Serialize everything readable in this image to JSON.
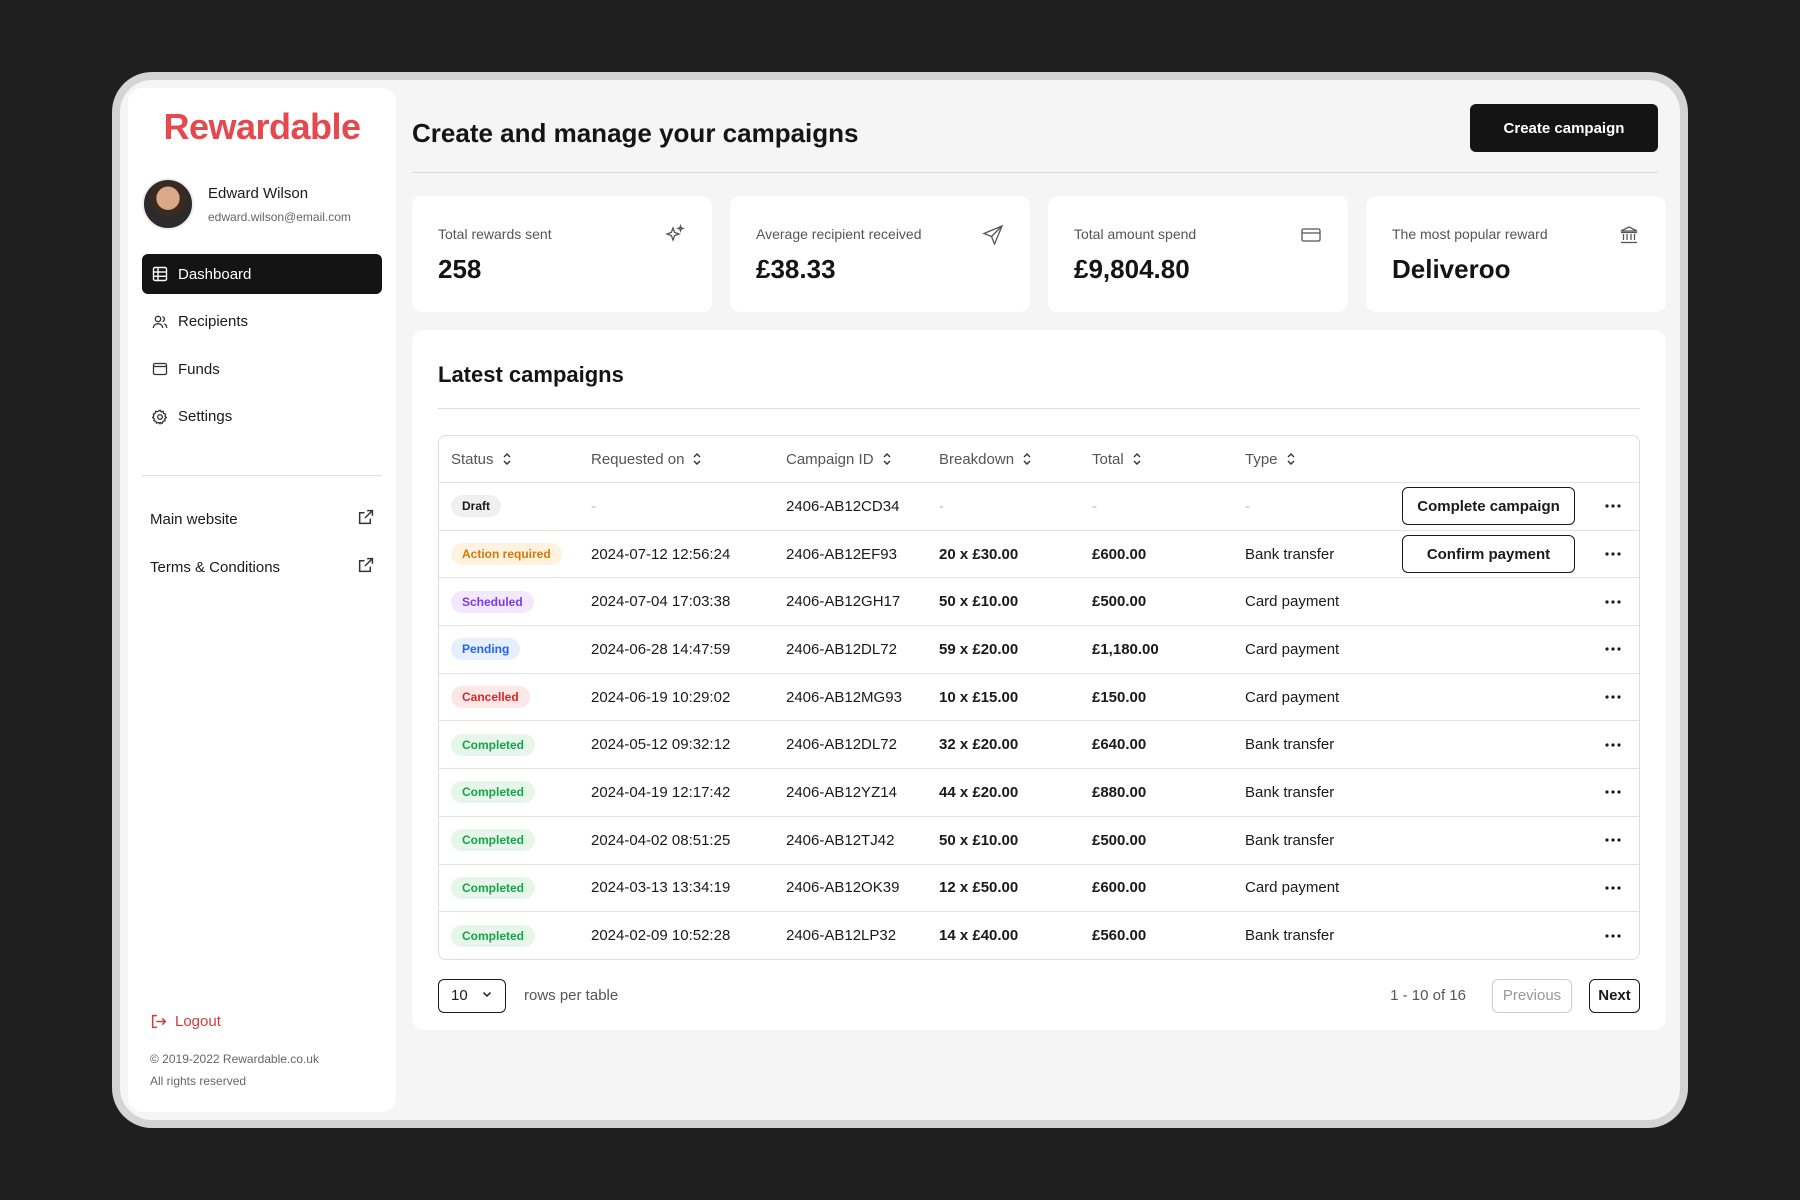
{
  "brand": {
    "name": "Rewardable",
    "color": "#e5484d"
  },
  "user": {
    "name": "Edward Wilson",
    "email": "edward.wilson@email.com"
  },
  "nav": [
    {
      "label": "Dashboard",
      "icon": "table-icon",
      "active": true
    },
    {
      "label": "Recipients",
      "icon": "users-icon",
      "active": false
    },
    {
      "label": "Funds",
      "icon": "wallet-icon",
      "active": false
    },
    {
      "label": "Settings",
      "icon": "gear-icon",
      "active": false
    }
  ],
  "links": [
    {
      "label": "Main website",
      "icon": "external-link-icon"
    },
    {
      "label": "Terms & Conditions",
      "icon": "external-link-icon"
    }
  ],
  "logout_label": "Logout",
  "footer": {
    "copyright": "© 2019-2022 Rewardable.co.uk",
    "rights": "All rights reserved"
  },
  "header": {
    "title": "Create and manage your campaigns",
    "create_label": "Create campaign"
  },
  "stats": [
    {
      "label": "Total rewards sent",
      "value": "258",
      "icon": "sparkle-icon"
    },
    {
      "label": "Average recipient received",
      "value": "£38.33",
      "icon": "send-icon"
    },
    {
      "label": "Total amount spend",
      "value": "£9,804.80",
      "icon": "card-icon"
    },
    {
      "label": "The most popular reward",
      "value": "Deliveroo",
      "icon": "bank-icon"
    }
  ],
  "campaigns": {
    "title": "Latest campaigns",
    "columns": [
      "Status",
      "Requested on",
      "Campaign ID",
      "Breakdown",
      "Total",
      "Type"
    ],
    "rows": [
      {
        "status": "Draft",
        "requested": "-",
        "id": "2406-AB12CD34",
        "breakdown": "-",
        "total": "-",
        "type": "-",
        "action": "Complete campaign"
      },
      {
        "status": "Action required",
        "requested": "2024-07-12 12:56:24",
        "id": "2406-AB12EF93",
        "breakdown": "20 x £30.00",
        "total": "£600.00",
        "type": "Bank transfer",
        "action": "Confirm payment"
      },
      {
        "status": "Scheduled",
        "requested": "2024-07-04 17:03:38",
        "id": "2406-AB12GH17",
        "breakdown": "50 x £10.00",
        "total": "£500.00",
        "type": "Card payment"
      },
      {
        "status": "Pending",
        "requested": "2024-06-28 14:47:59",
        "id": "2406-AB12DL72",
        "breakdown": "59 x £20.00",
        "total": "£1,180.00",
        "type": "Card payment"
      },
      {
        "status": "Cancelled",
        "requested": "2024-06-19 10:29:02",
        "id": "2406-AB12MG93",
        "breakdown": "10 x £15.00",
        "total": "£150.00",
        "type": "Card payment"
      },
      {
        "status": "Completed",
        "requested": "2024-05-12 09:32:12",
        "id": "2406-AB12DL72",
        "breakdown": "32 x £20.00",
        "total": "£640.00",
        "type": "Bank transfer"
      },
      {
        "status": "Completed",
        "requested": "2024-04-19 12:17:42",
        "id": "2406-AB12YZ14",
        "breakdown": "44 x £20.00",
        "total": "£880.00",
        "type": "Bank transfer"
      },
      {
        "status": "Completed",
        "requested": "2024-04-02 08:51:25",
        "id": "2406-AB12TJ42",
        "breakdown": "50 x £10.00",
        "total": "£500.00",
        "type": "Bank transfer"
      },
      {
        "status": "Completed",
        "requested": "2024-03-13 13:34:19",
        "id": "2406-AB12OK39",
        "breakdown": "12 x £50.00",
        "total": "£600.00",
        "type": "Card payment"
      },
      {
        "status": "Completed",
        "requested": "2024-02-09 10:52:28",
        "id": "2406-AB12LP32",
        "breakdown": "14 x £40.00",
        "total": "£560.00",
        "type": "Bank transfer"
      }
    ]
  },
  "pagination": {
    "rows_value": "10",
    "rows_label": "rows per table",
    "count": "1 - 10 of 16",
    "prev_label": "Previous",
    "next_label": "Next"
  }
}
